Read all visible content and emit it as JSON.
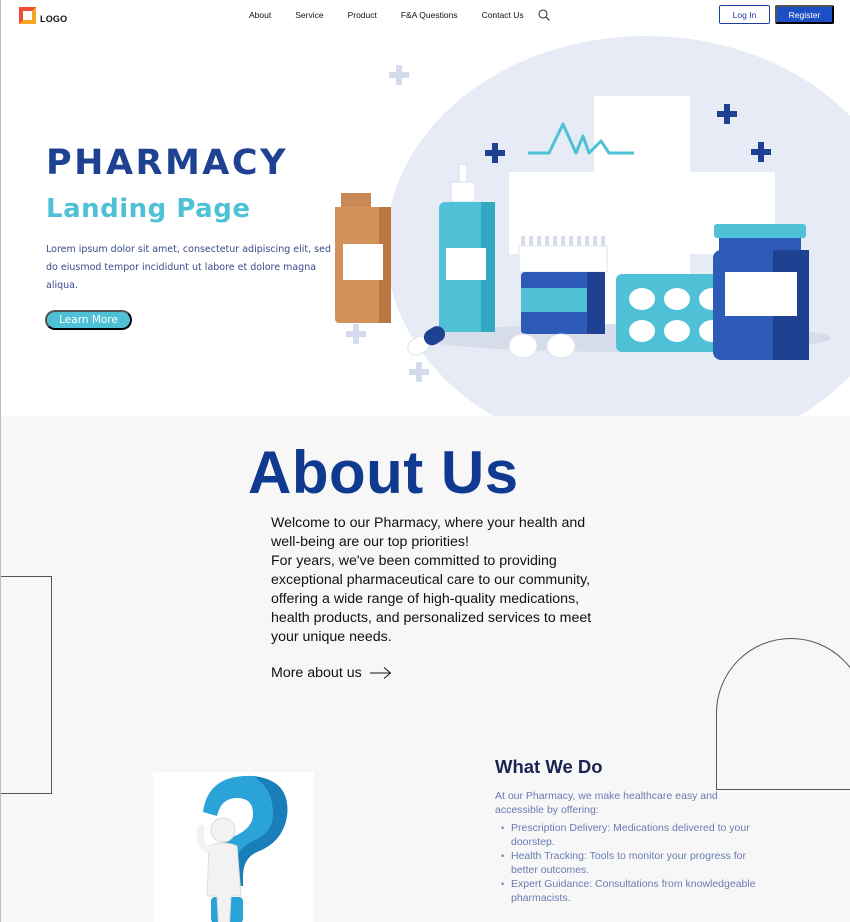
{
  "header": {
    "logo_text": "LOGO",
    "nav": [
      "About",
      "Service",
      "Product",
      "F&A Questions",
      "Contact Us"
    ],
    "login_label": "Log In",
    "register_label": "Register"
  },
  "hero": {
    "title": "PHARMACY",
    "subtitle": "Landing Page",
    "description": "Lorem ipsum dolor sit amet, consectetur adipiscing elit, sed do eiusmod tempor incididunt ut labore et dolore magna aliqua.",
    "cta_label": "Learn More"
  },
  "about": {
    "title": "About Us",
    "paragraph1": "Welcome to our Pharmacy, where your health and well-being are our top priorities!",
    "paragraph2": "For years, we've been committed to providing exceptional pharmaceutical care to our community, offering a wide range of high-quality medications, health products, and personalized services to meet your unique needs.",
    "more_link": "More about us"
  },
  "what_we_do": {
    "title": "What We Do",
    "intro": "At our Pharmacy, we make healthcare easy and accessible by offering:",
    "items": [
      "Prescription Delivery: Medications delivered to your doorstep.",
      "Health Tracking: Tools to monitor your progress for better outcomes.",
      "Expert Guidance: Consultations from knowledgeable pharmacists."
    ]
  },
  "colors": {
    "brand_dark": "#1f4191",
    "brand_light": "#4ec1d6",
    "register_bg": "#1d4fc4",
    "hero_blob": "#e6ebf5",
    "about_bg": "#f7f7f8"
  },
  "icons": [
    "logo-mark-icon",
    "search-icon",
    "arrow-right-icon",
    "question-mark-figure"
  ]
}
